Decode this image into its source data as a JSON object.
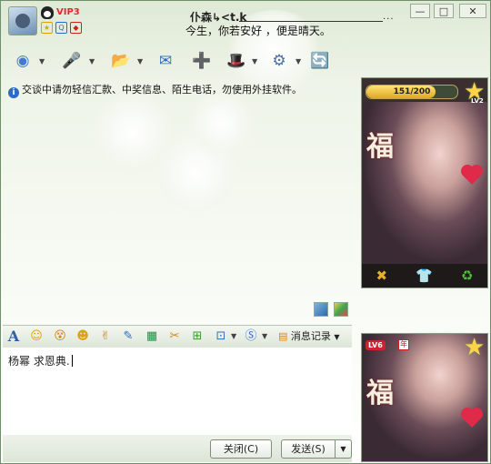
{
  "title_bar": {
    "badge": "VIP3",
    "contact_name": "仆森↳<t.k",
    "signature": "今生，你若安好 ，便是晴天。",
    "dots": "...",
    "minimize_label": "—",
    "maximize_label": "□",
    "close_label": "✕"
  },
  "toolbar": {
    "icons": [
      "video-call-icon",
      "voice-call-icon",
      "send-file-icon",
      "send-message-icon",
      "add-app-icon",
      "remote-assist-icon",
      "settings-icon",
      "share-icon"
    ],
    "glyphs": [
      "◉",
      "🎤",
      "📂",
      "✉",
      "➕",
      "🎩",
      "⚙",
      "🔄"
    ]
  },
  "notice": "交谈中请勿轻信汇款、中奖信息、陌生电话，勿使用外挂软件。",
  "format_bar": {
    "font_glyph": "A",
    "buttons": [
      "☺",
      "😵",
      "☻",
      "✌",
      "✎",
      "▦",
      "✂",
      "⊞",
      "⊡",
      "Ⓢ"
    ],
    "history_label": "消息记录"
  },
  "input": {
    "value": "杨幂 求恩典."
  },
  "bottom": {
    "close_button": "关闭(C)",
    "send_button": "发送(S)",
    "send_menu_glyph": "▼"
  },
  "show_panel": {
    "progress_text": "151/200",
    "progress_value": 0.755,
    "level_top": "LV2",
    "action_icons": [
      "✖",
      "👕",
      "♻"
    ],
    "level_bottom": "LV6",
    "year_badge": "年",
    "fu_glyph": "福"
  },
  "colors": {
    "accent_green": "#7fa56b",
    "red": "#c9242f",
    "gold": "#e0a81e"
  }
}
